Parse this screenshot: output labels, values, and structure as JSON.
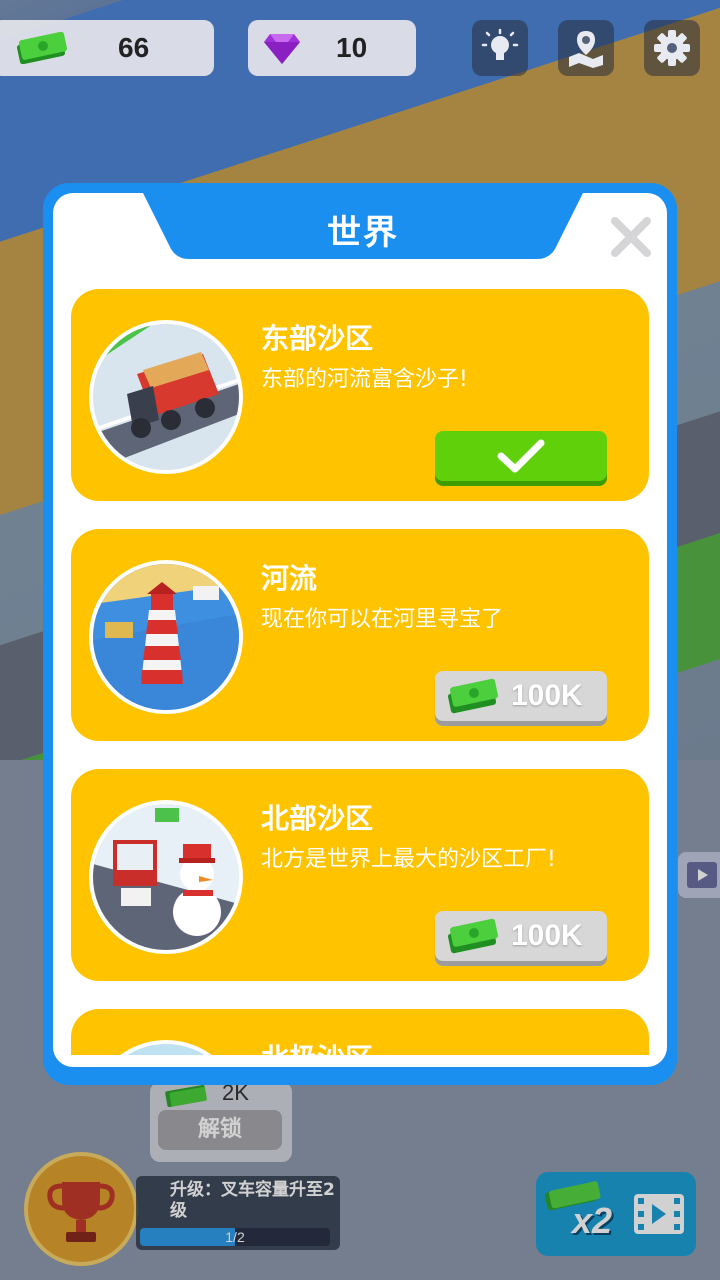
{
  "hud": {
    "cash": "66",
    "gems": "10",
    "icons": [
      "cash-icon",
      "gem-icon",
      "lightbulb-icon",
      "map-icon",
      "gear-icon"
    ]
  },
  "dialog": {
    "title": "世界",
    "regions": [
      {
        "name": "东部沙区",
        "desc": "东部的河流富含沙子!",
        "status": "unlocked"
      },
      {
        "name": "河流",
        "desc": "现在你可以在河里寻宝了",
        "price": "100K"
      },
      {
        "name": "北部沙区",
        "desc": "北方是世界上最大的沙区工厂!",
        "price": "100K"
      },
      {
        "name": "北极沙区",
        "desc": ""
      }
    ]
  },
  "bottom": {
    "unlock_label": "解锁",
    "unlock_price": "2K",
    "upgrade_text": "升级：叉车容量升至2级",
    "upgrade_progress": "1/2",
    "upgrade_fraction": 0.5,
    "boost_label": "x2"
  },
  "colors": {
    "panel_blue": "#1a8ff0",
    "card_yellow": "#ffc300",
    "ok_green": "#5fd00a"
  }
}
